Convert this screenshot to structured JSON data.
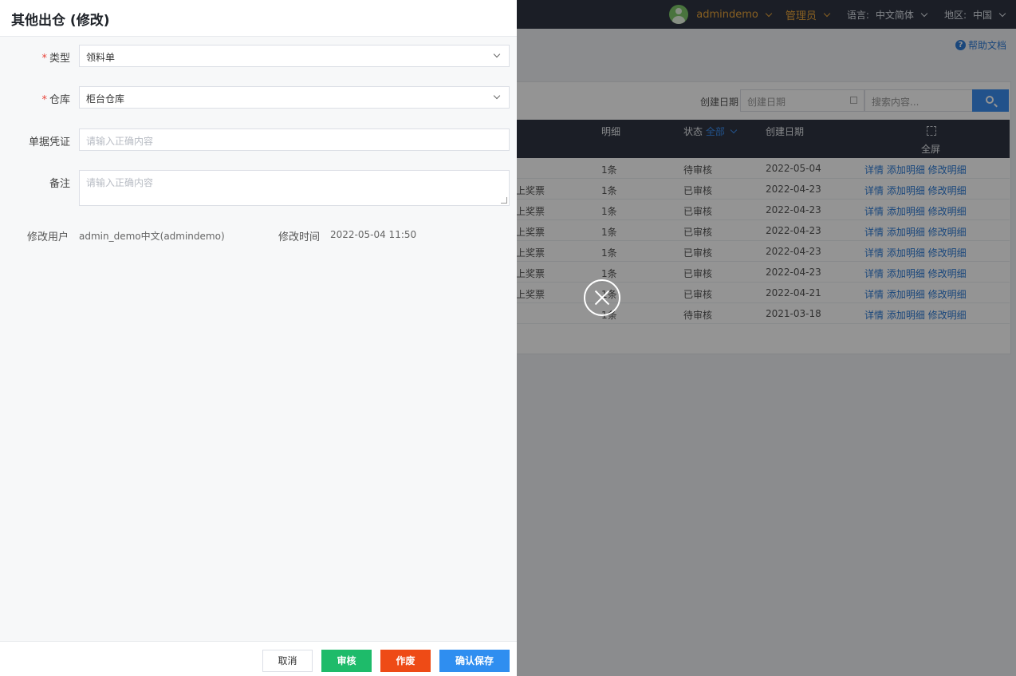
{
  "topbar": {
    "username": "admindemo",
    "role": "管理员",
    "language_label": "语言:",
    "language_value": "中文简体",
    "region_label": "地区:",
    "region_value": "中国"
  },
  "help": {
    "label": "帮助文档"
  },
  "filters": {
    "date_label": "创建日期",
    "date_placeholder": "创建日期",
    "search_placeholder": "搜索内容..."
  },
  "table": {
    "headers": {
      "detail": "明细",
      "status": "状态",
      "status_filter": "全部",
      "created": "创建日期",
      "fullscreen": "全屏"
    },
    "rows": [
      {
        "name": "",
        "detail": "1条",
        "status": "待审核",
        "date": "2022-05-04"
      },
      {
        "name": "上奖票",
        "detail": "1条",
        "status": "已审核",
        "date": "2022-04-23"
      },
      {
        "name": "上奖票",
        "detail": "1条",
        "status": "已审核",
        "date": "2022-04-23"
      },
      {
        "name": "上奖票",
        "detail": "1条",
        "status": "已审核",
        "date": "2022-04-23"
      },
      {
        "name": "上奖票",
        "detail": "1条",
        "status": "已审核",
        "date": "2022-04-23"
      },
      {
        "name": "上奖票",
        "detail": "1条",
        "status": "已审核",
        "date": "2022-04-23"
      },
      {
        "name": "上奖票",
        "detail": "1条",
        "status": "已审核",
        "date": "2022-04-21"
      },
      {
        "name": "",
        "detail": "1条",
        "status": "待审核",
        "date": "2021-03-18"
      }
    ],
    "action_links": "详情 添加明细 修改明细"
  },
  "drawer": {
    "title": "其他出仓 (修改)",
    "required_mark": "*",
    "type_label": "类型",
    "type_value": "领料单",
    "warehouse_label": "仓库",
    "warehouse_value": "柜台仓库",
    "voucher_label": "单据凭证",
    "voucher_placeholder": "请输入正确内容",
    "remark_label": "备注",
    "remark_placeholder": "请输入正确内容",
    "modifier_label": "修改用户",
    "modifier_value": "admin_demo中文(admindemo)",
    "modified_time_label": "修改时间",
    "modified_time_value": "2022-05-04 11:50"
  },
  "footer": {
    "cancel": "取消",
    "audit": "审核",
    "void": "作废",
    "save": "确认保存"
  },
  "colors": {
    "topbar": "#2f3542",
    "accent_blue": "#2f8ef0",
    "audit_green": "#1ebb6a",
    "void_red": "#ee4b16",
    "required_red": "#e8443a",
    "user_orange": "#e8a43c"
  }
}
